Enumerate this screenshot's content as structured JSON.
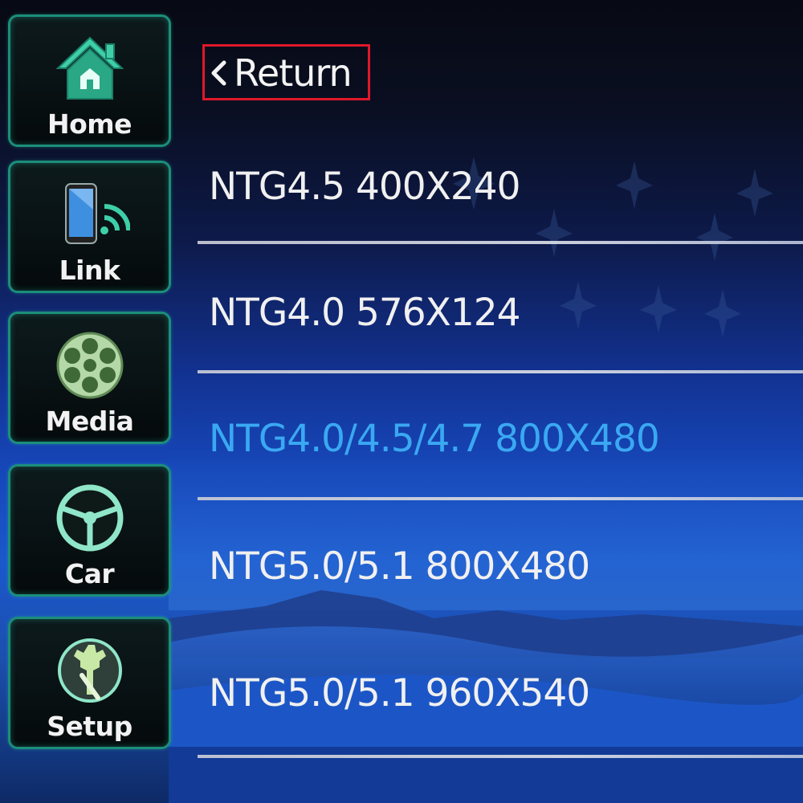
{
  "colors": {
    "accent_teal": "#1c8e7a",
    "selected_blue": "#3aa8f2",
    "return_border_red": "#e0182a",
    "text_white": "#f0f0f0"
  },
  "sidebar": {
    "items": [
      {
        "label": "Home",
        "icon": "home-icon"
      },
      {
        "label": "Link",
        "icon": "phone-link-icon"
      },
      {
        "label": "Media",
        "icon": "film-reel-icon"
      },
      {
        "label": "Car",
        "icon": "steering-wheel-icon"
      },
      {
        "label": "Setup",
        "icon": "settings-wrench-icon"
      }
    ]
  },
  "main": {
    "return_label": "Return",
    "return_icon": "chevron-left-icon",
    "options": [
      {
        "label": "NTG4.5 400X240"
      },
      {
        "label": "NTG4.0 576X124"
      },
      {
        "label": "NTG4.0/4.5/4.7 800X480",
        "selected": true
      },
      {
        "label": "NTG5.0/5.1 800X480"
      },
      {
        "label": "NTG5.0/5.1 960X540"
      }
    ]
  }
}
